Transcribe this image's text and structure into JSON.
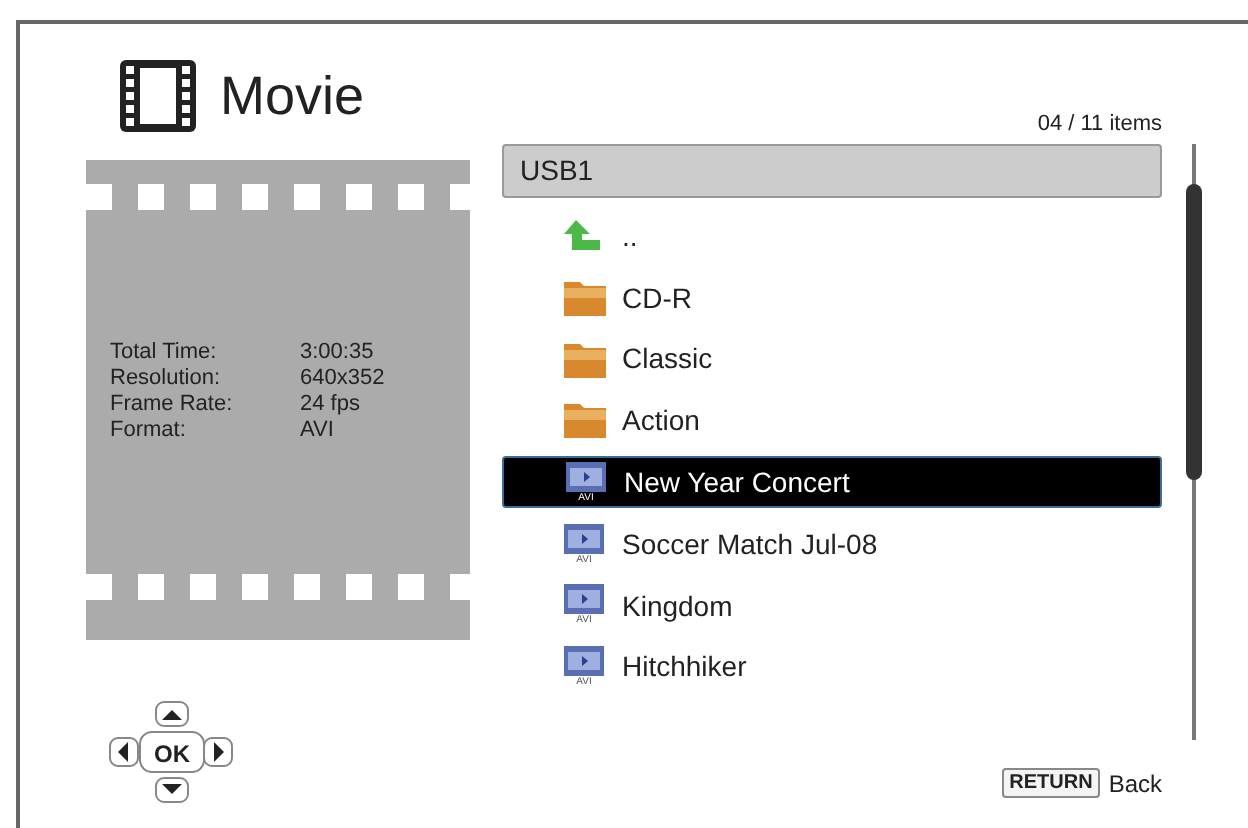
{
  "header": {
    "title": "Movie",
    "item_count": "04 / 11 items"
  },
  "info": [
    {
      "label": "Total Time:",
      "value": "3:00:35"
    },
    {
      "label": "Resolution:",
      "value": "640x352"
    },
    {
      "label": "Frame Rate:",
      "value": "24 fps"
    },
    {
      "label": "Format:",
      "value": "AVI"
    }
  ],
  "nav_pad": {
    "center": "OK"
  },
  "browser": {
    "path": "USB1",
    "items": [
      {
        "kind": "up",
        "name": "..",
        "selected": false
      },
      {
        "kind": "folder",
        "name": "CD-R",
        "selected": false
      },
      {
        "kind": "folder",
        "name": "Classic",
        "selected": false
      },
      {
        "kind": "folder",
        "name": "Action",
        "selected": false
      },
      {
        "kind": "video",
        "name": "New Year Concert",
        "badge": "AVI",
        "selected": true
      },
      {
        "kind": "video",
        "name": "Soccer Match Jul-08",
        "badge": "AVI",
        "selected": false
      },
      {
        "kind": "video",
        "name": "Kingdom",
        "badge": "AVI",
        "selected": false
      },
      {
        "kind": "video",
        "name": "Hitchhiker",
        "badge": "AVI",
        "selected": false
      }
    ]
  },
  "footer": {
    "key": "RETURN",
    "action": "Back"
  }
}
